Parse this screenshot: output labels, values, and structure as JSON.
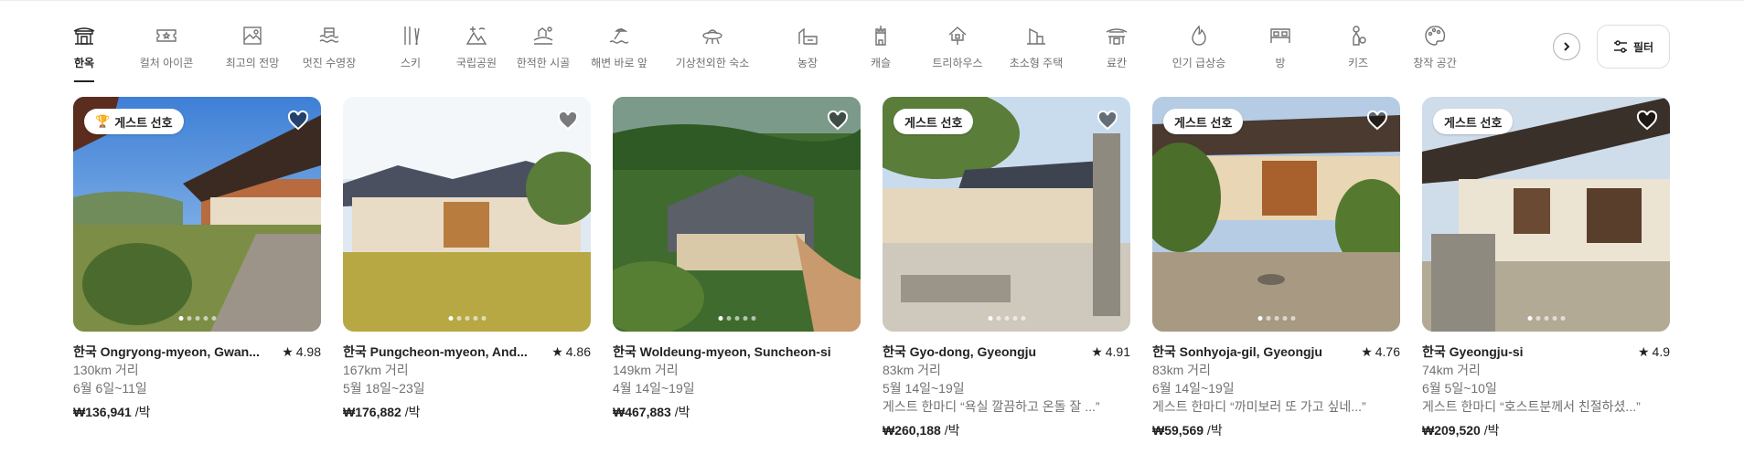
{
  "categories": [
    {
      "label": "한옥",
      "icon": "hanok-icon",
      "active": true
    },
    {
      "label": "컬처 아이콘",
      "icon": "ticket-icon",
      "active": false
    },
    {
      "label": "최고의 전망",
      "icon": "view-frame-icon",
      "active": false
    },
    {
      "label": "멋진 수영장",
      "icon": "pool-icon",
      "active": false
    },
    {
      "label": "스키",
      "icon": "ski-icon",
      "active": false
    },
    {
      "label": "국립공원",
      "icon": "national-park-icon",
      "active": false
    },
    {
      "label": "한적한 시골",
      "icon": "countryside-icon",
      "active": false
    },
    {
      "label": "해변 바로 앞",
      "icon": "beachfront-icon",
      "active": false
    },
    {
      "label": "기상천외한 숙소",
      "icon": "ufo-icon",
      "active": false
    },
    {
      "label": "농장",
      "icon": "farm-icon",
      "active": false
    },
    {
      "label": "캐슬",
      "icon": "castle-icon",
      "active": false
    },
    {
      "label": "트리하우스",
      "icon": "treehouse-icon",
      "active": false
    },
    {
      "label": "초소형 주택",
      "icon": "tiny-house-icon",
      "active": false
    },
    {
      "label": "료칸",
      "icon": "ryokan-icon",
      "active": false
    },
    {
      "label": "인기 급상승",
      "icon": "flame-icon",
      "active": false
    },
    {
      "label": "방",
      "icon": "bed-icon",
      "active": false
    },
    {
      "label": "키즈",
      "icon": "kids-icon",
      "active": false
    },
    {
      "label": "창작 공간",
      "icon": "palette-icon",
      "active": false
    }
  ],
  "filter_label": "필터",
  "listings": [
    {
      "title": "한국 Ongryong-myeon, Gwan...",
      "rating": "4.98",
      "distance": "130km 거리",
      "dates": "6월 6일~11일",
      "review": "",
      "price": "₩136,941",
      "per": " /박",
      "badge": "게스트 선호",
      "badge_trophy": true,
      "favorite": false
    },
    {
      "title": "한국 Pungcheon-myeon, And...",
      "rating": "4.86",
      "distance": "167km 거리",
      "dates": "5월 18일~23일",
      "review": "",
      "price": "₩176,882",
      "per": " /박",
      "badge": "",
      "badge_trophy": false,
      "favorite": false
    },
    {
      "title": "한국 Woldeung-myeon, Suncheon-si",
      "rating": "",
      "distance": "149km 거리",
      "dates": "4월 14일~19일",
      "review": "",
      "price": "₩467,883",
      "per": " /박",
      "badge": "",
      "badge_trophy": false,
      "favorite": false
    },
    {
      "title": "한국 Gyo-dong, Gyeongju",
      "rating": "4.91",
      "distance": "83km 거리",
      "dates": "5월 14일~19일",
      "review": "게스트 한마디 “욕실 깔끔하고 온돌 잘 ...”",
      "price": "₩260,188",
      "per": " /박",
      "badge": "게스트 선호",
      "badge_trophy": false,
      "favorite": false
    },
    {
      "title": "한국 Sonhyoja-gil, Gyeongju",
      "rating": "4.76",
      "distance": "83km 거리",
      "dates": "6월 14일~19일",
      "review": "게스트 한마디 “까미보러 또 가고 싶네...”",
      "price": "₩59,569",
      "per": " /박",
      "badge": "게스트 선호",
      "badge_trophy": false,
      "favorite": false
    },
    {
      "title": "한국 Gyeongju-si",
      "rating": "4.9",
      "distance": "74km 거리",
      "dates": "6월 5일~10일",
      "review": "게스트 한마디 “호스트분께서 친절하셨...”",
      "price": "₩209,520",
      "per": " /박",
      "badge": "게스트 선호",
      "badge_trophy": false,
      "favorite": false
    }
  ],
  "colors": {
    "text": "#222222",
    "muted": "#717171",
    "border": "#dddddd"
  }
}
